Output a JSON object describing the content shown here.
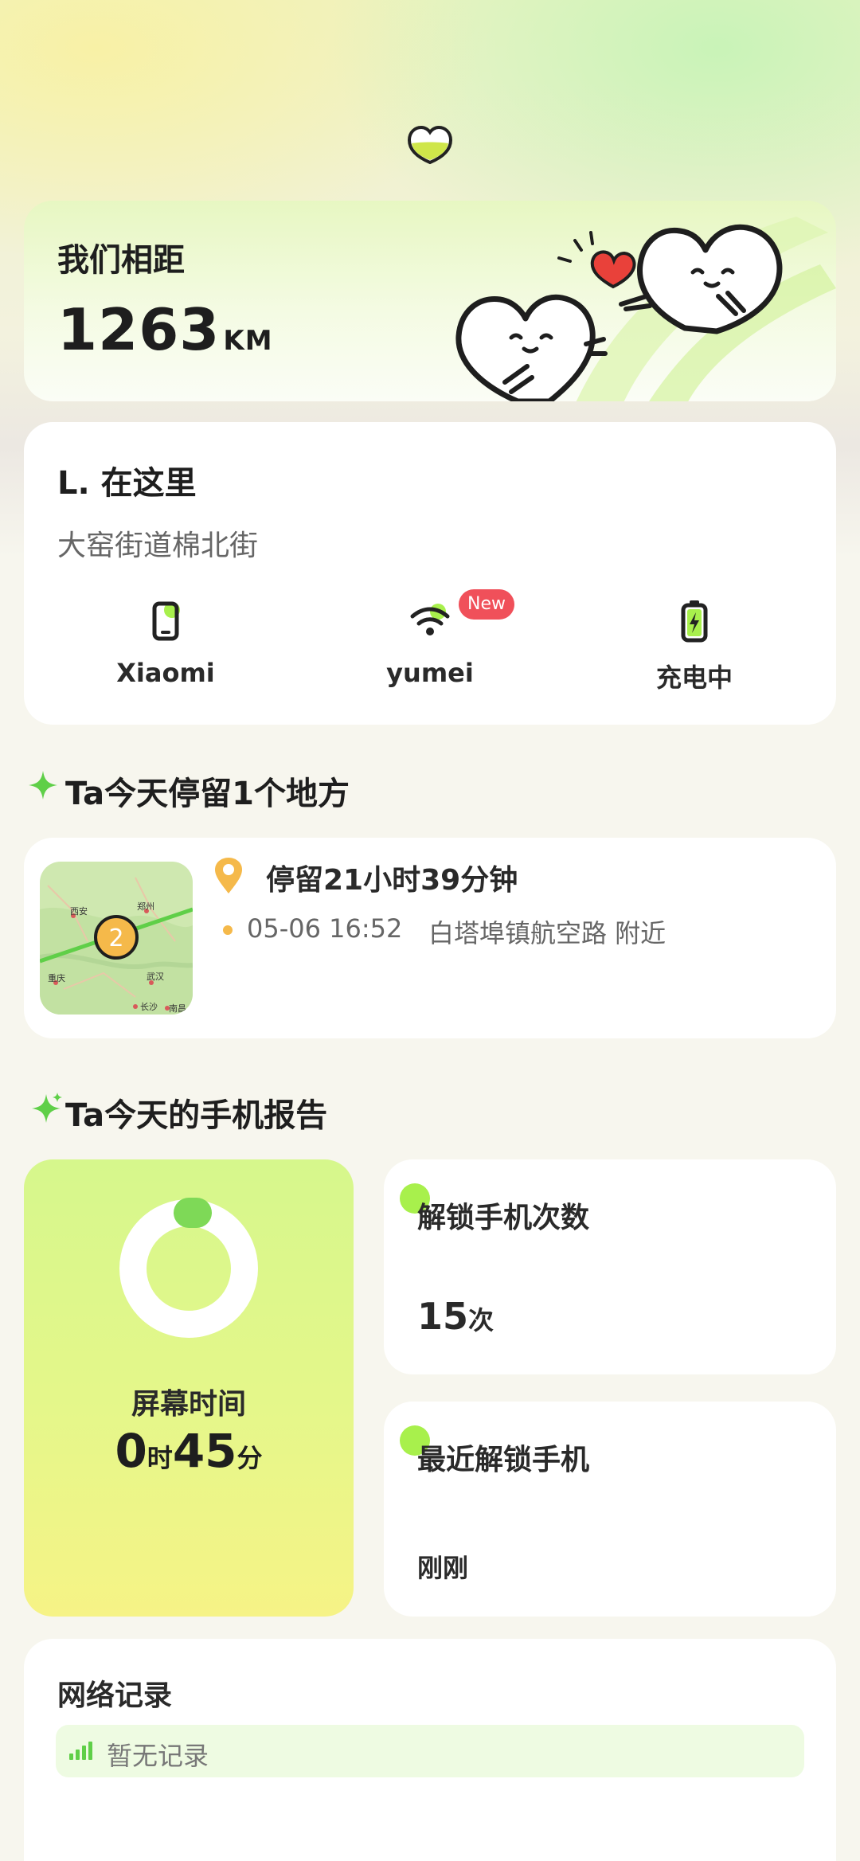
{
  "distance": {
    "title": "我们相距",
    "value": "1263",
    "unit": "KM"
  },
  "location": {
    "name": "L. 在这里",
    "address": "大窑街道棉北街",
    "device": "Xiaomi",
    "wifi": "yumei",
    "wifi_badge": "New",
    "battery": "充电中"
  },
  "stay_section": {
    "title": "Ta今天停留1个地方"
  },
  "stay": {
    "duration": "停留21小时39分钟",
    "time": "05-06 16:52",
    "place": "白塔埠镇航空路 附近",
    "map_count": "2",
    "map_labels": [
      "西安",
      "郑州",
      "重庆",
      "武汉",
      "长沙",
      "南昌"
    ]
  },
  "report_section": {
    "title": "Ta今天的手机报告"
  },
  "screen_time": {
    "label": "屏幕时间",
    "hours": "0",
    "hours_unit": "时",
    "minutes": "45",
    "minutes_unit": "分"
  },
  "unlock_count": {
    "title": "解锁手机次数",
    "value": "15",
    "unit": "次"
  },
  "last_unlock": {
    "title": "最近解锁手机",
    "value": "刚刚"
  },
  "network": {
    "title": "网络记录",
    "empty": "暂无记录"
  },
  "colors": {
    "accent_green": "#a8f04c",
    "badge_red": "#f0505a",
    "pin_orange": "#f5b94a"
  }
}
